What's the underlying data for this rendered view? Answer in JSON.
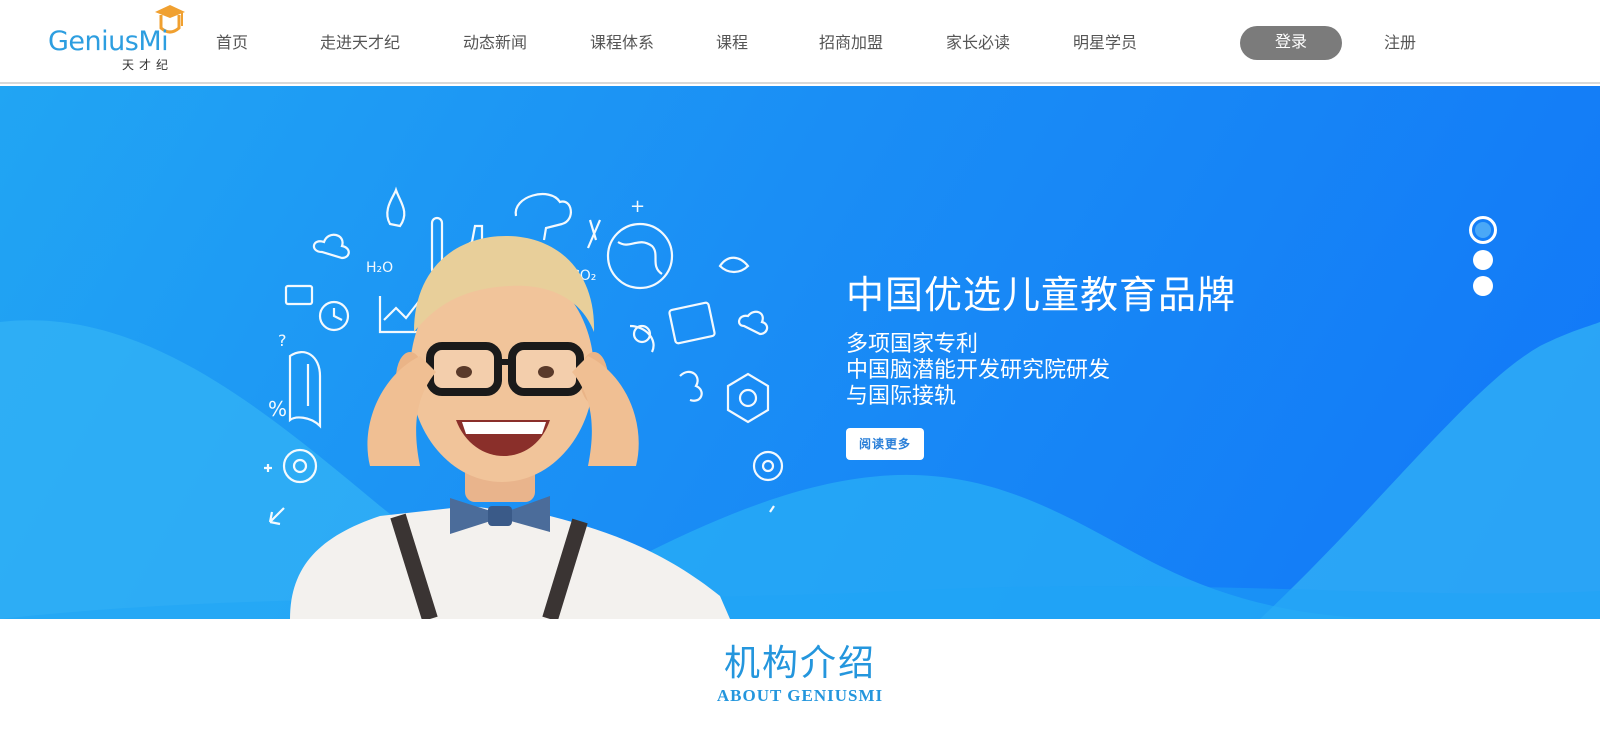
{
  "header": {
    "logo": {
      "word": "GeniusMi",
      "cn": "天才纪"
    },
    "nav": [
      {
        "id": "home",
        "label": "首页"
      },
      {
        "id": "about",
        "label": "走进天才纪"
      },
      {
        "id": "news",
        "label": "动态新闻"
      },
      {
        "id": "system",
        "label": "课程体系"
      },
      {
        "id": "courses",
        "label": "课程"
      },
      {
        "id": "franchise",
        "label": "招商加盟"
      },
      {
        "id": "parents",
        "label": "家长必读"
      },
      {
        "id": "stars",
        "label": "明星学员"
      }
    ],
    "login_label": "登录",
    "register_label": "注册"
  },
  "banner": {
    "title": "中国优选儿童教育品牌",
    "lines": [
      "多项国家专利",
      "中国脑潜能开发研究院研发",
      "与国际接轨"
    ],
    "read_more_label": "阅读更多",
    "slides": 3,
    "active_slide": 1
  },
  "section": {
    "title_cn": "机构介绍",
    "title_en": "ABOUT GENIUSMI"
  },
  "colors": {
    "brand_blue": "#2d9ee0",
    "banner_blue": "#1a8ef5",
    "login_gray": "#7b7b7b",
    "logo_orange": "#f0a030"
  }
}
